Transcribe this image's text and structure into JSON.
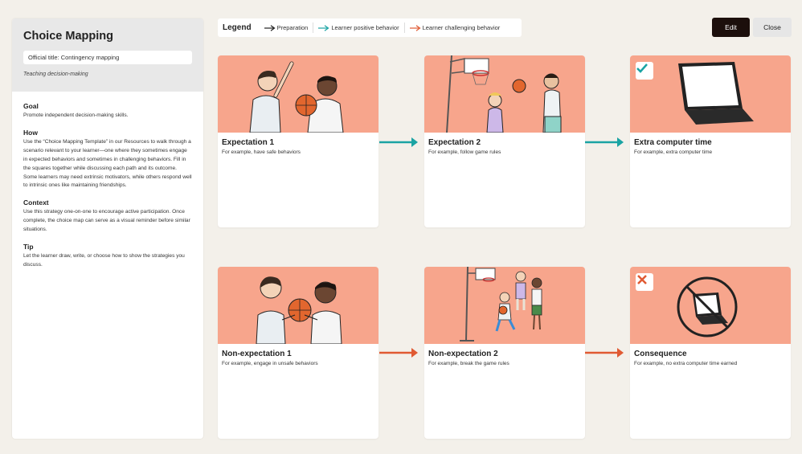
{
  "sidebar": {
    "title": "Choice Mapping",
    "official_title": "Official title: Contingency mapping",
    "subtitle": "Teaching decision-making",
    "sections": [
      {
        "heading": "Goal",
        "text": "Promote independent decision-making skills."
      },
      {
        "heading": "How",
        "text": "Use the “Choice Mapping Template” in our Resources to walk through a scenario relevant to your learner—one where they sometimes engage in expected behaviors and sometimes in challenging behaviors. Fill in the squares together while discussing each path and its outcome. Some learners may need extrinsic motivators, while others respond well to intrinsic ones like maintaining friendships."
      },
      {
        "heading": "Context",
        "text": "Use this strategy one-on-one to encourage active participation. Once complete, the choice map can serve as a visual reminder before similar situations."
      },
      {
        "heading": "Tip",
        "text": "Let the learner draw, write, or choose how to show the strategies you discuss."
      }
    ]
  },
  "legend": {
    "title": "Legend",
    "items": [
      {
        "label": "Preparation",
        "color": "#222222"
      },
      {
        "label": "Learner positive behavior",
        "color": "#1aa3a3"
      },
      {
        "label": "Learner challenging behavior",
        "color": "#e05a33"
      }
    ]
  },
  "buttons": {
    "edit": "Edit",
    "close": "Close"
  },
  "cards": [
    {
      "title": "Expectation 1",
      "text": "For example, have safe behaviors",
      "image": "two-kids-basketball-icon"
    },
    {
      "title": "Expectation 2",
      "text": "For example, follow game rules",
      "image": "basketball-hoop-icon"
    },
    {
      "title": "Extra computer time",
      "text": "For example, extra computer time",
      "image": "laptop-check-icon"
    },
    {
      "title": "Non-expectation 1",
      "text": "For example, engage in unsafe behaviors",
      "image": "two-kids-grab-ball-icon"
    },
    {
      "title": "Non-expectation 2",
      "text": "For example, break the game rules",
      "image": "kids-running-hoop-icon"
    },
    {
      "title": "Consequence",
      "text": "For example, no extra computer time earned",
      "image": "no-laptop-icon"
    }
  ],
  "colors": {
    "card_image_bg": "#f7a58c",
    "positive": "#1aa3a3",
    "challenging": "#e05a33"
  }
}
